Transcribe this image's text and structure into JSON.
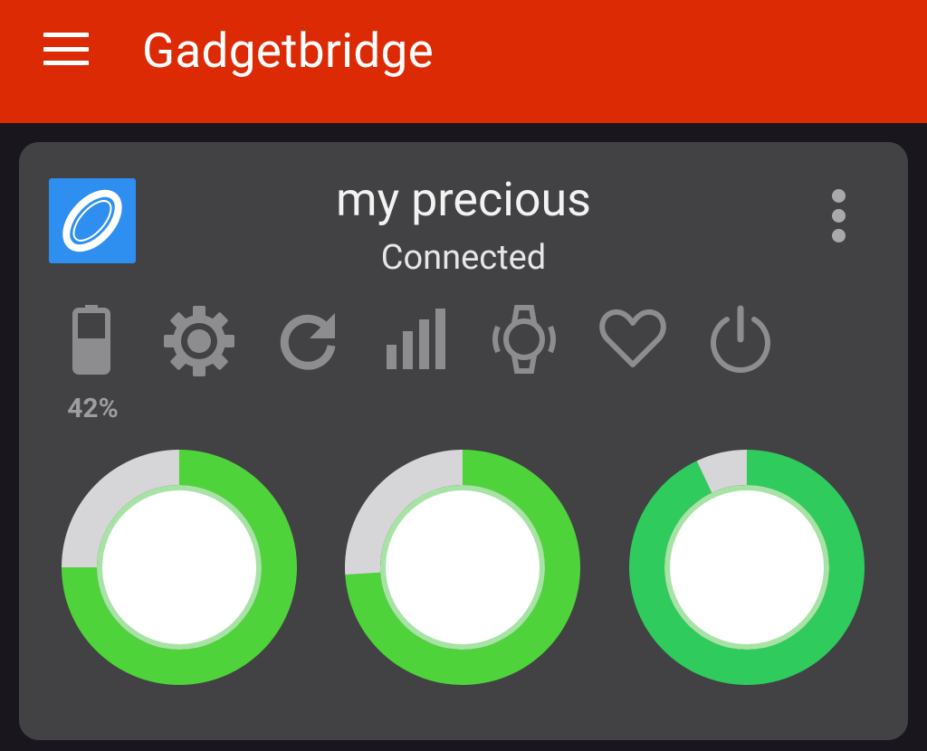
{
  "app_bar": {
    "title": "Gadgetbridge",
    "menu_icon": "hamburger-menu-icon",
    "color": "#dc2a04"
  },
  "device_card": {
    "name": "my precious",
    "status": "Connected",
    "device_icon": "ring-device-icon",
    "overflow_icon": "more-vert-icon",
    "battery": {
      "percent_label": "42%",
      "level": 0.42
    },
    "actions": [
      {
        "id": "battery",
        "icon": "battery-icon"
      },
      {
        "id": "settings",
        "icon": "gear-icon"
      },
      {
        "id": "sync",
        "icon": "refresh-icon"
      },
      {
        "id": "activity",
        "icon": "bar-chart-icon"
      },
      {
        "id": "find",
        "icon": "find-device-watch-icon"
      },
      {
        "id": "heart",
        "icon": "heart-icon"
      },
      {
        "id": "disconnect",
        "icon": "power-icon"
      }
    ]
  },
  "chart_data": [
    {
      "type": "pie",
      "values": [
        {
          "label": "progress",
          "value": 0.75,
          "color": "#4fd33a"
        },
        {
          "label": "remaining",
          "value": 0.25,
          "color": "#d6d5d7"
        }
      ]
    },
    {
      "type": "pie",
      "values": [
        {
          "label": "progress",
          "value": 0.74,
          "color": "#4fd33a"
        },
        {
          "label": "remaining",
          "value": 0.26,
          "color": "#d6d5d7"
        }
      ]
    },
    {
      "type": "pie",
      "values": [
        {
          "label": "progress",
          "value": 0.93,
          "color": "#2fcb5c"
        },
        {
          "label": "remaining",
          "value": 0.07,
          "color": "#d6d5d7"
        }
      ]
    }
  ]
}
